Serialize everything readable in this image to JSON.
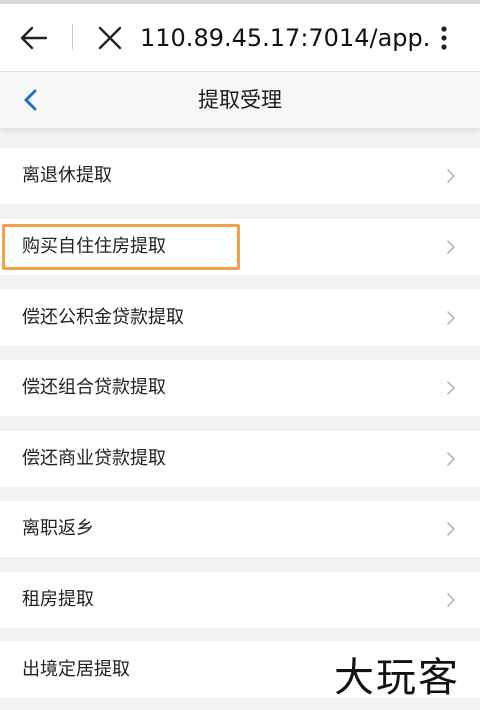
{
  "browser": {
    "url": "110.89.45.17:7014/app..."
  },
  "header": {
    "title": "提取受理"
  },
  "items": [
    {
      "label": "离退休提取"
    },
    {
      "label": "购买自住住房提取"
    },
    {
      "label": "偿还公积金贷款提取"
    },
    {
      "label": "偿还组合贷款提取"
    },
    {
      "label": "偿还商业贷款提取"
    },
    {
      "label": "离职返乡"
    },
    {
      "label": "租房提取"
    },
    {
      "label": "出境定居提取"
    }
  ],
  "highlighted_item": "购买自住住房提取",
  "watermark": "大玩客",
  "colors": {
    "accent": "#1a73c8",
    "highlight": "#f0a050",
    "background": "#f2f2f4",
    "chevron": "#b8b8b8"
  },
  "icons": {
    "browser_back": "back-arrow-icon",
    "browser_close": "close-icon",
    "browser_menu": "more-vertical-icon",
    "page_back": "chevron-left-icon",
    "row_arrow": "chevron-right-icon"
  }
}
